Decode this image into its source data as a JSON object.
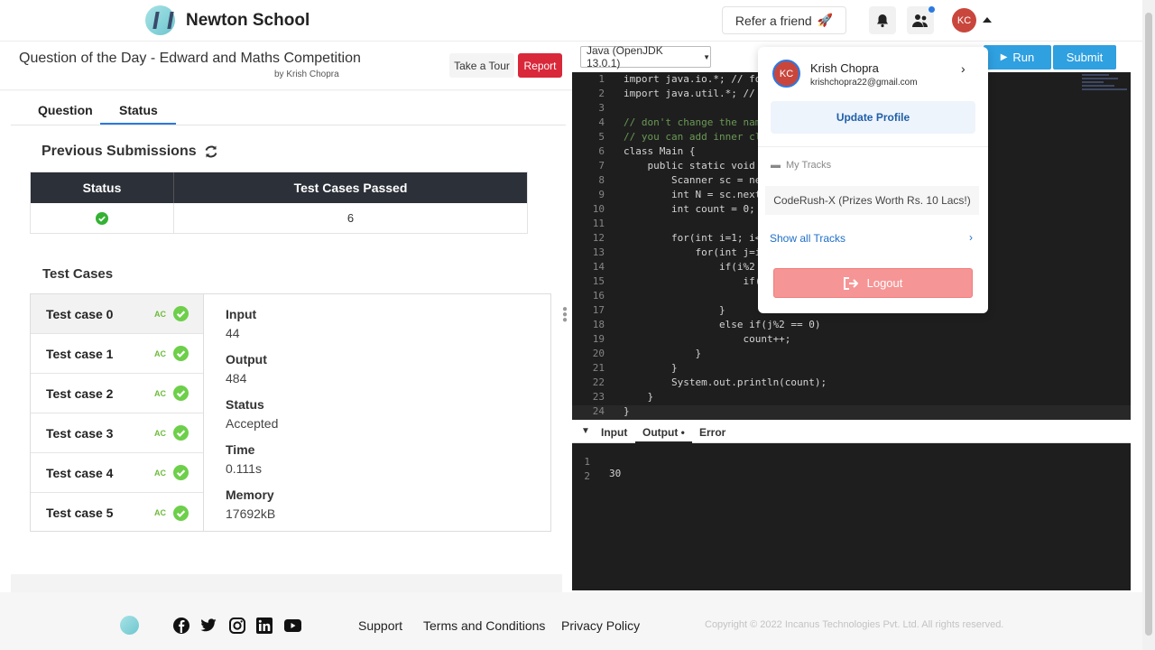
{
  "header": {
    "brand": "Newton School",
    "refer_label": "Refer a friend",
    "avatar_initials": "KC"
  },
  "question": {
    "title": "Question of the Day - Edward and Maths Competition",
    "author": "by Krish Chopra",
    "tour_label": "Take a Tour",
    "report_label": "Report",
    "tabs": [
      "Question",
      "Status"
    ]
  },
  "submissions": {
    "title": "Previous Submissions",
    "headers": [
      "Status",
      "Test Cases Passed"
    ],
    "rows": [
      {
        "status_icon": "check-circle-icon",
        "passed": "6"
      }
    ]
  },
  "test_cases": {
    "title": "Test Cases",
    "items": [
      {
        "name": "Test case 0",
        "badge": "AC"
      },
      {
        "name": "Test case 1",
        "badge": "AC"
      },
      {
        "name": "Test case 2",
        "badge": "AC"
      },
      {
        "name": "Test case 3",
        "badge": "AC"
      },
      {
        "name": "Test case 4",
        "badge": "AC"
      },
      {
        "name": "Test case 5",
        "badge": "AC"
      }
    ],
    "detail": {
      "input_label": "Input",
      "input": "44",
      "output_label": "Output",
      "output": "484",
      "status_label": "Status",
      "status": "Accepted",
      "time_label": "Time",
      "time": "0.111s",
      "memory_label": "Memory",
      "memory": "17692kB"
    }
  },
  "editor": {
    "language": "Java (OpenJDK 13.0.1)",
    "run_label": "Run",
    "submit_label": "Submit",
    "lines": [
      {
        "n": "1",
        "t": "import java.io.*; // fo"
      },
      {
        "n": "2",
        "t": "import java.util.*; // "
      },
      {
        "n": "3",
        "t": ""
      },
      {
        "n": "4",
        "t": "// don't change the name"
      },
      {
        "n": "5",
        "t": "// you can add inner cla"
      },
      {
        "n": "6",
        "t": "class Main {"
      },
      {
        "n": "7",
        "t": "    public static void m"
      },
      {
        "n": "8",
        "t": "        Scanner sc = new"
      },
      {
        "n": "9",
        "t": "        int N = sc.nextI"
      },
      {
        "n": "10",
        "t": "        int count = 0;"
      },
      {
        "n": "11",
        "t": ""
      },
      {
        "n": "12",
        "t": "        for(int i=1; i<"
      },
      {
        "n": "13",
        "t": "            for(int j=i"
      },
      {
        "n": "14",
        "t": "                if(i%2"
      },
      {
        "n": "15",
        "t": "                    if("
      },
      {
        "n": "16",
        "t": ""
      },
      {
        "n": "17",
        "t": "                }"
      },
      {
        "n": "18",
        "t": "                else if(j%2 == 0)"
      },
      {
        "n": "19",
        "t": "                    count++;"
      },
      {
        "n": "20",
        "t": "            }"
      },
      {
        "n": "21",
        "t": "        }"
      },
      {
        "n": "22",
        "t": "        System.out.println(count);"
      },
      {
        "n": "23",
        "t": "    }"
      },
      {
        "n": "24",
        "t": "}"
      }
    ]
  },
  "io": {
    "tabs": [
      "Input",
      "Output •",
      "Error"
    ],
    "lines": [
      {
        "n": "1",
        "t": "30"
      },
      {
        "n": "2",
        "t": ""
      }
    ]
  },
  "dropdown": {
    "name": "Krish Chopra",
    "email": "krishchopra22@gmail.com",
    "update_label": "Update Profile",
    "tracks_label": "My Tracks",
    "track_item": "CodeRush-X (Prizes Worth Rs. 10 Lacs!)",
    "show_tracks": "Show all Tracks",
    "logout_label": "Logout"
  },
  "footer": {
    "links": [
      "Support",
      "Terms and Conditions",
      "Privacy Policy"
    ],
    "copyright": "Copyright © 2022 Incanus Technologies Pvt. Ltd. All rights reserved.",
    "social_icons": [
      "facebook-icon",
      "twitter-icon",
      "instagram-icon",
      "linkedin-icon",
      "youtube-icon"
    ]
  },
  "colors": {
    "accent": "#2a7ae2",
    "report": "#d9283a",
    "run": "#2fa0e0",
    "success": "#34b233",
    "logout": "#f69595"
  }
}
